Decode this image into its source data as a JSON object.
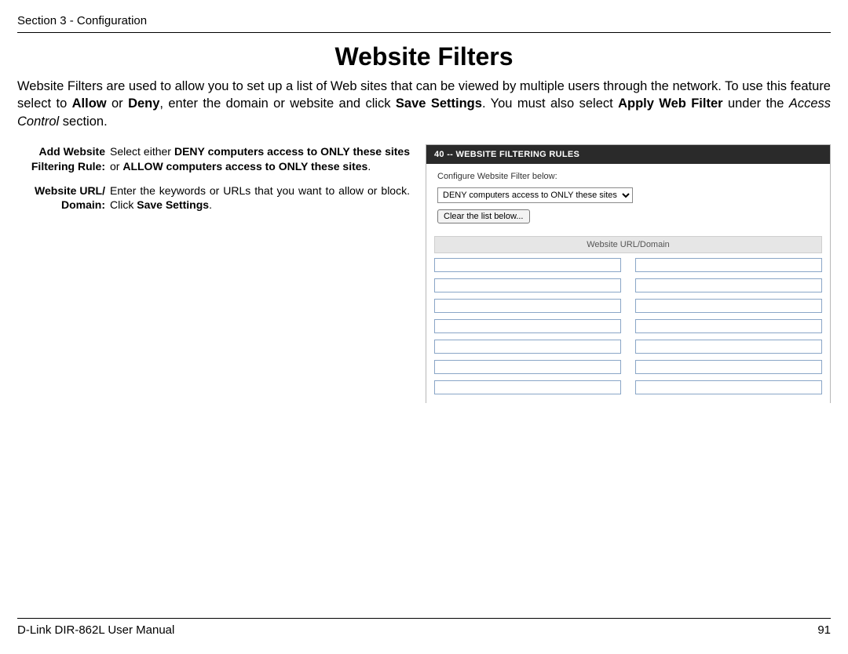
{
  "header": {
    "section": "Section 3 - Configuration"
  },
  "title": "Website Filters",
  "intro": {
    "t1": "Website Filters are used to allow you to set up a list of Web sites that can be viewed by multiple users through the network. To use this feature select to ",
    "allow": "Allow",
    "t2": " or ",
    "deny": "Deny",
    "t3": ", enter the domain or website and click ",
    "save": "Save Settings",
    "t4": ". You must also select ",
    "apply": "Apply Web Filter",
    "t5": " under the ",
    "access": "Access Control",
    "t6": " section."
  },
  "defs": {
    "label1a": "Add Website",
    "label1b": "Filtering Rule:",
    "val1_pre": "Select either ",
    "val1_b1": "DENY computers access to ONLY these sites",
    "val1_mid": " or ",
    "val1_b2": "ALLOW computers access to ONLY these sites",
    "val1_post": ".",
    "label2a": "Website URL/",
    "label2b": "Domain:",
    "val2_pre": "Enter the keywords or URLs that you want to allow or block. Click ",
    "val2_b": "Save Settings",
    "val2_post": "."
  },
  "panel": {
    "titlebar": "40 -- WEBSITE FILTERING RULES",
    "configure_label": "Configure Website Filter below:",
    "dropdown_value": "DENY computers access to ONLY these sites",
    "clear_button": "Clear the list below...",
    "grid_header": "Website URL/Domain",
    "rows": 7
  },
  "footer": {
    "manual": "D-Link DIR-862L User Manual",
    "page": "91"
  }
}
